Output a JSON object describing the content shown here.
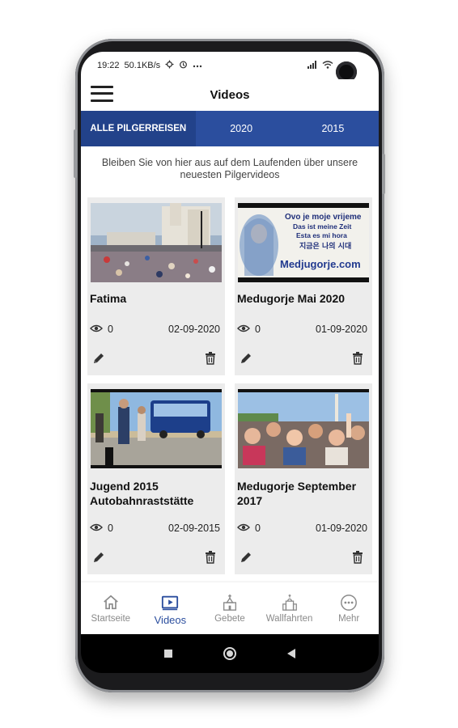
{
  "status_bar": {
    "time": "19:22",
    "speed": "50.1KB/s"
  },
  "app_bar": {
    "title": "Videos",
    "menu_icon": "hamburger-menu-icon"
  },
  "tabs": [
    {
      "label": "ALLE PILGERREISEN",
      "active": true
    },
    {
      "label": "2020",
      "active": false
    },
    {
      "label": "2015",
      "active": false
    }
  ],
  "intro_text": "Bleiben Sie von hier aus auf dem Laufenden über unsere neuesten Pilgervideos",
  "thumbnail_texts": {
    "line1": "Ovo je moje vrijeme",
    "line2": "Das ist meine Zeit",
    "line3": "Esta es mi hora",
    "line4": "지금은 나의 시대",
    "line5": "Medjugorje.com"
  },
  "videos": [
    {
      "title": "Fatima",
      "views": "0",
      "date": "02-09-2020"
    },
    {
      "title": "Medugorje Mai 2020",
      "views": "0",
      "date": "01-09-2020"
    },
    {
      "title": "Jugend 2015 Autobahnraststätte",
      "views": "0",
      "date": "02-09-2015"
    },
    {
      "title": "Medugorje September 2017",
      "views": "0",
      "date": "01-09-2020"
    }
  ],
  "bottom_nav": [
    {
      "label": "Startseite",
      "icon": "home-icon",
      "active": false
    },
    {
      "label": "Videos",
      "icon": "video-play-icon",
      "active": true
    },
    {
      "label": "Gebete",
      "icon": "church-icon",
      "active": false
    },
    {
      "label": "Wallfahrten",
      "icon": "cathedral-icon",
      "active": false
    },
    {
      "label": "Mehr",
      "icon": "more-dots-icon",
      "active": false
    }
  ],
  "colors": {
    "primary": "#2b4e9e",
    "tab_active": "#22428a",
    "card_bg": "#ececec",
    "nav_inactive": "#8a8a8a"
  }
}
